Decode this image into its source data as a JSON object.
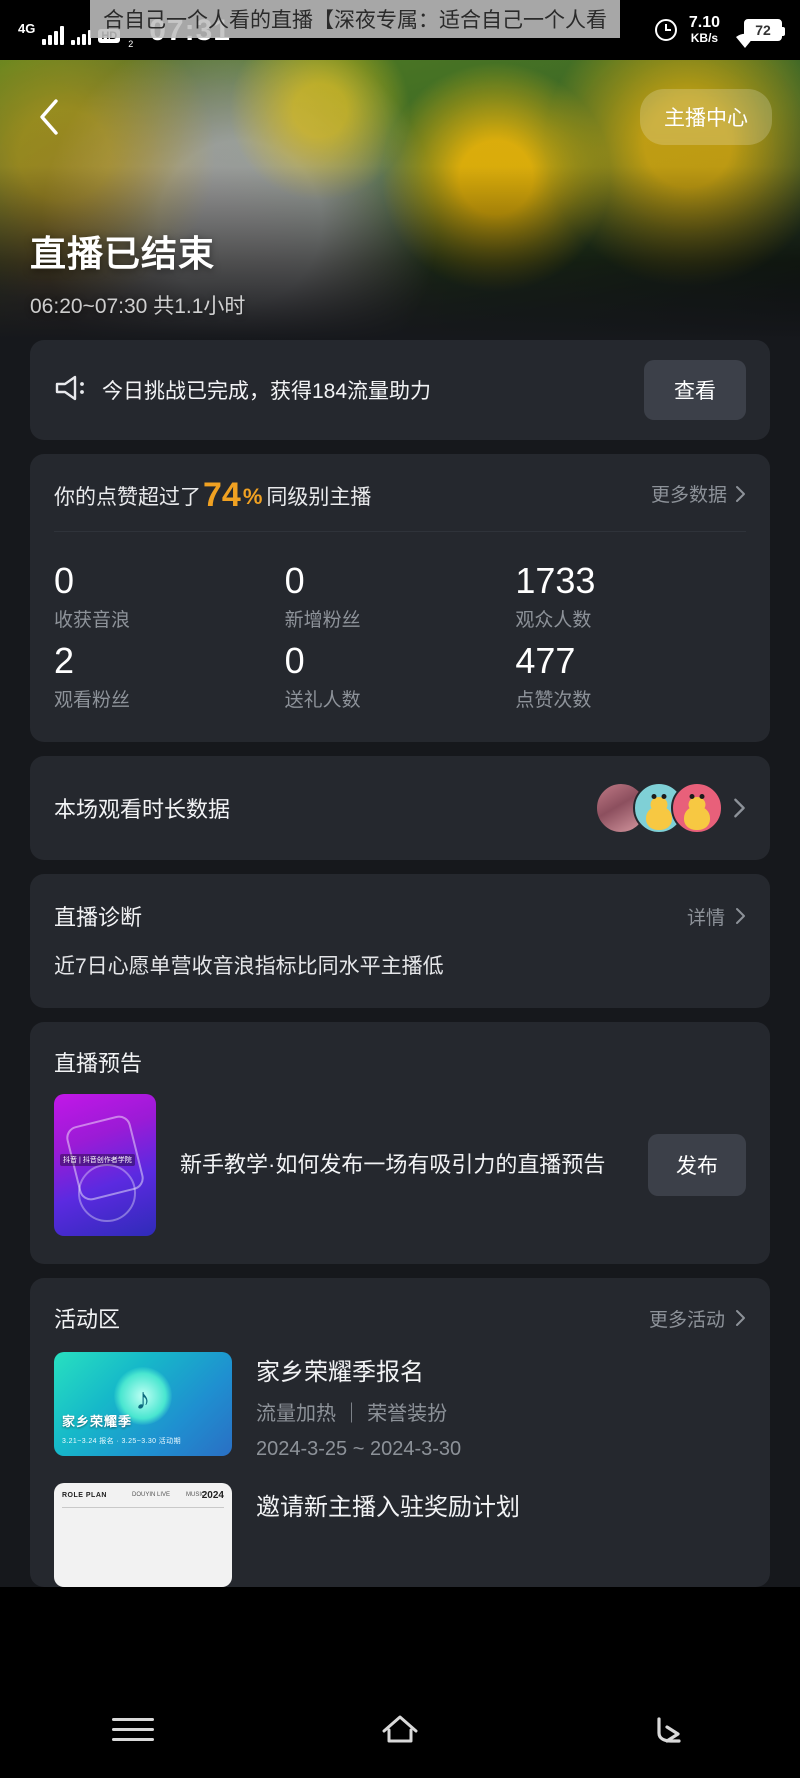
{
  "statusbar": {
    "network_type": "4G",
    "hd_badge": "HD",
    "hd_sub": "2",
    "time": "07:31",
    "net_speed_value": "7.10",
    "net_speed_unit": "KB/s",
    "battery": "72",
    "overlay_text": "合自己一个人看的直播【深夜专属：适合自己一个人看",
    "icons": {
      "signal": "signal-bars-icon",
      "clock": "clock-icon",
      "wifi": "wifi-icon",
      "battery": "battery-icon"
    }
  },
  "hero": {
    "back_icon": "chevron-left-icon",
    "anchor_center_label": "主播中心",
    "title": "直播已结束",
    "subtitle": "06:20~07:30 共1.1小时"
  },
  "challenge": {
    "icon": "horn-icon",
    "text": "今日挑战已完成，获得184流量助力",
    "button_label": "查看"
  },
  "performance": {
    "prefix": "你的点赞超过了",
    "percent": "74",
    "percent_sign": "%",
    "suffix": "同级别主播",
    "more_label": "更多数据",
    "more_icon": "chevron-right-icon",
    "stats": [
      {
        "value": "0",
        "label": "收获音浪"
      },
      {
        "value": "0",
        "label": "新增粉丝"
      },
      {
        "value": "1733",
        "label": "观众人数"
      },
      {
        "value": "2",
        "label": "观看粉丝"
      },
      {
        "value": "0",
        "label": "送礼人数"
      },
      {
        "value": "477",
        "label": "点赞次数"
      }
    ]
  },
  "watch_duration": {
    "title": "本场观看时长数据",
    "chevron_icon": "chevron-right-icon",
    "avatars": [
      "avatar-user-1",
      "avatar-user-2",
      "avatar-user-3"
    ]
  },
  "diagnosis": {
    "title": "直播诊断",
    "detail_label": "详情",
    "detail_icon": "chevron-right-icon",
    "note": "近7日心愿单营收音浪指标比同水平主播低"
  },
  "live_preview": {
    "section_title": "直播预告",
    "thumb_tag": "抖音 | 抖音创作者学院",
    "item_title": "新手教学·如何发布一场有吸引力的直播预告",
    "button_label": "发布"
  },
  "activity": {
    "section_title": "活动区",
    "more_label": "更多活动",
    "more_icon": "chevron-right-icon",
    "items": [
      {
        "title": "家乡荣耀季报名",
        "subtitle": "流量加热 ｜ 荣誉装扮",
        "date": "2024-3-25 ~ 2024-3-30",
        "thumb_ribbon": "家乡荣耀季",
        "thumb_sub": "3.21~3.24 报名 · 3.25~3.30 活动期",
        "thumb_note": "♪"
      },
      {
        "title": "邀请新主播入驻奖励计划",
        "thumb_label_left": "ROLE PLAN",
        "thumb_label_mid": "DOUYIN LIVE",
        "thumb_label_right": "MUSIC",
        "thumb_year": "2024"
      }
    ]
  },
  "navbar": {
    "menu_icon": "menu-icon",
    "home_icon": "home-icon",
    "back_icon": "back-arrow-icon"
  },
  "colors": {
    "page_bg": "#16181c",
    "card_bg": "#25282e",
    "accent": "#f0a122",
    "muted_text": "#8d9299",
    "button_bg": "#3c4049"
  }
}
